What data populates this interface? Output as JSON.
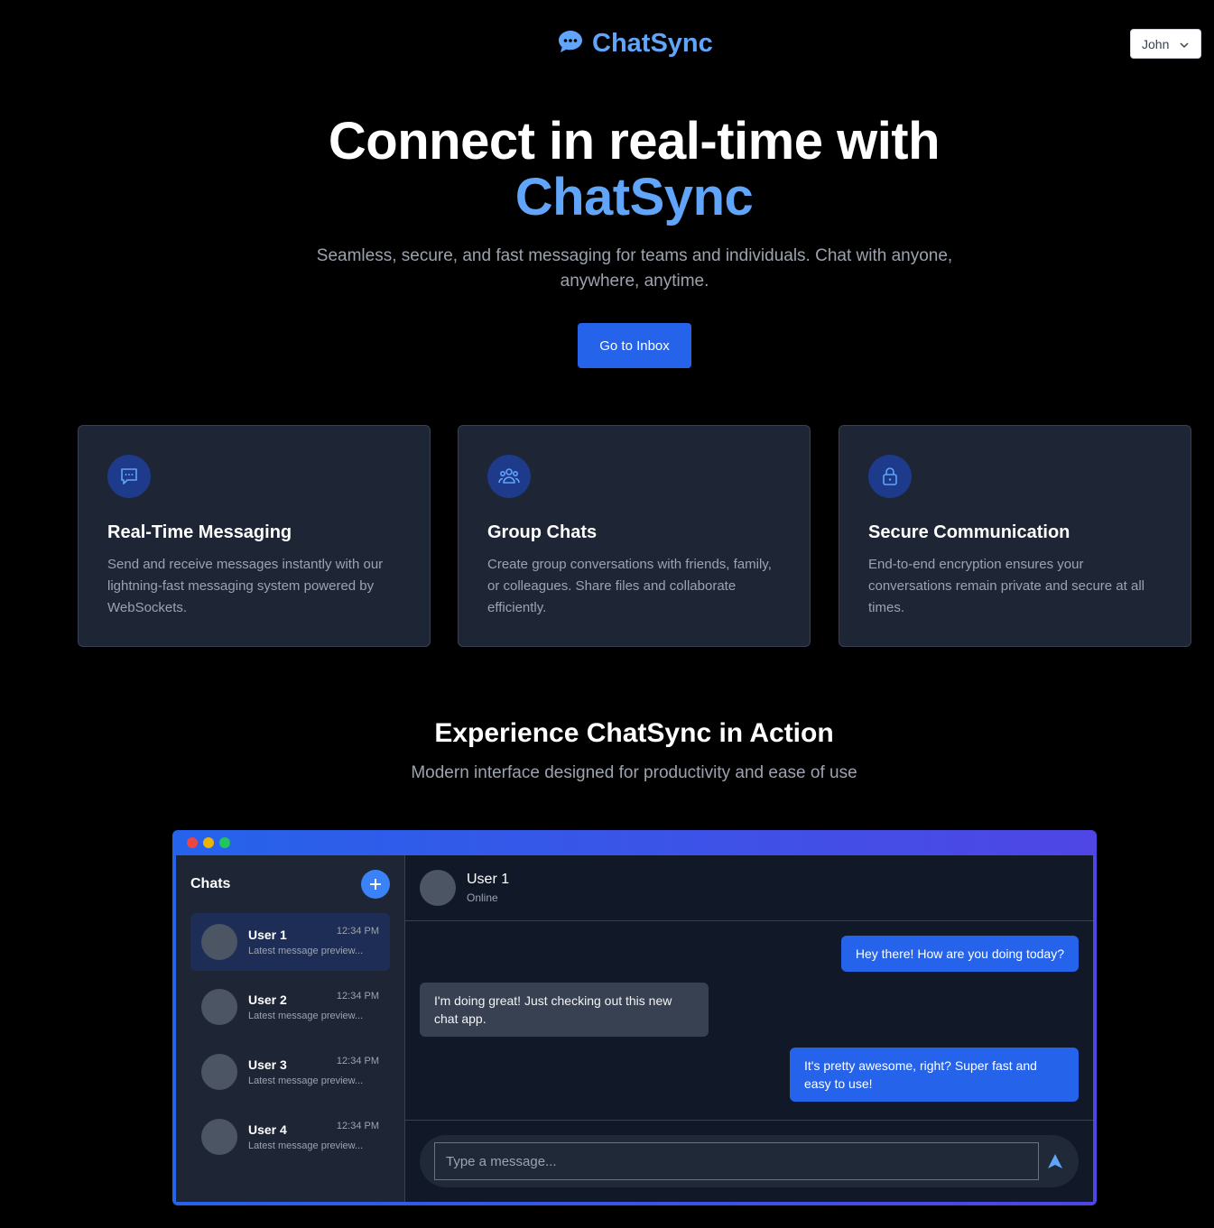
{
  "header": {
    "brand": "ChatSync",
    "brand_icon": "chat-bubble-icon",
    "user_select_value": "John"
  },
  "hero": {
    "title_line1": "Connect in real-time with",
    "title_line2": "ChatSync",
    "subtitle": "Seamless, secure, and fast messaging for teams and individuals. Chat with anyone, anywhere, anytime.",
    "cta_label": "Go to Inbox"
  },
  "features": [
    {
      "icon": "message-icon",
      "title": "Real-Time Messaging",
      "text": "Send and receive messages instantly with our lightning-fast messaging system powered by WebSockets."
    },
    {
      "icon": "group-icon",
      "title": "Group Chats",
      "text": "Create group conversations with friends, family, or colleagues. Share files and collaborate efficiently."
    },
    {
      "icon": "lock-icon",
      "title": "Secure Communication",
      "text": "End-to-end encryption ensures your conversations remain private and secure at all times."
    }
  ],
  "showcase": {
    "title": "Experience ChatSync in Action",
    "subtitle": "Modern interface designed for productivity and ease of use"
  },
  "mockup": {
    "sidebar_title": "Chats",
    "chats": [
      {
        "name": "User 1",
        "time": "12:34 PM",
        "preview": "Latest message preview..."
      },
      {
        "name": "User 2",
        "time": "12:34 PM",
        "preview": "Latest message preview..."
      },
      {
        "name": "User 3",
        "time": "12:34 PM",
        "preview": "Latest message preview..."
      },
      {
        "name": "User 4",
        "time": "12:34 PM",
        "preview": "Latest message preview..."
      }
    ],
    "active_chat": {
      "name": "User 1",
      "status": "Online"
    },
    "messages": [
      {
        "dir": "out",
        "text": "Hey there! How are you doing today?"
      },
      {
        "dir": "in",
        "text": "I'm doing great! Just checking out this new chat app."
      },
      {
        "dir": "out",
        "text": "It's pretty awesome, right? Super fast and easy to use!"
      }
    ],
    "input_placeholder": "Type a message..."
  },
  "colors": {
    "accent": "#60a5fa",
    "primary": "#2563eb",
    "card_bg": "#1e2535",
    "window_dot_red": "#ef4444",
    "window_dot_yellow": "#eab308",
    "window_dot_green": "#22c55e"
  }
}
